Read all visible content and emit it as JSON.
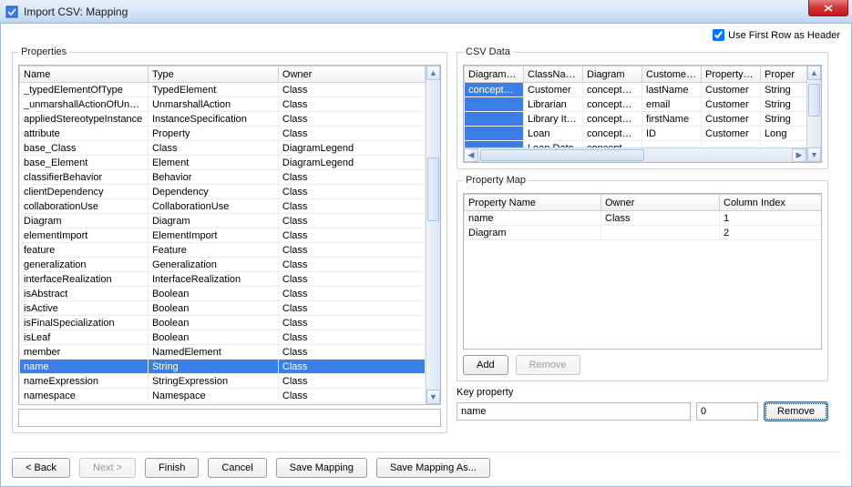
{
  "window": {
    "title": "Import CSV: Mapping"
  },
  "header_checkbox": {
    "label": "Use First Row as Header",
    "checked": true
  },
  "groups": {
    "properties": "Properties",
    "csv": "CSV Data",
    "propmap": "Property Map"
  },
  "properties_table": {
    "headers": [
      "Name",
      "Type",
      "Owner"
    ],
    "rows": [
      {
        "name": "_typedElementOfType",
        "type": "TypedElement",
        "owner": "Class"
      },
      {
        "name": "_unmarshallActionOfUnma...",
        "type": "UnmarshallAction",
        "owner": "Class"
      },
      {
        "name": "appliedStereotypeInstance",
        "type": "InstanceSpecification",
        "owner": "Class"
      },
      {
        "name": "attribute",
        "type": "Property",
        "owner": "Class"
      },
      {
        "name": "base_Class",
        "type": "Class",
        "owner": "DiagramLegend"
      },
      {
        "name": "base_Element",
        "type": "Element",
        "owner": "DiagramLegend"
      },
      {
        "name": "classifierBehavior",
        "type": "Behavior",
        "owner": "Class"
      },
      {
        "name": "clientDependency",
        "type": "Dependency",
        "owner": "Class"
      },
      {
        "name": "collaborationUse",
        "type": "CollaborationUse",
        "owner": "Class"
      },
      {
        "name": "Diagram",
        "type": "Diagram",
        "owner": "Class"
      },
      {
        "name": "elementImport",
        "type": "ElementImport",
        "owner": "Class"
      },
      {
        "name": "feature",
        "type": "Feature",
        "owner": "Class"
      },
      {
        "name": "generalization",
        "type": "Generalization",
        "owner": "Class"
      },
      {
        "name": "interfaceRealization",
        "type": "InterfaceRealization",
        "owner": "Class"
      },
      {
        "name": "isAbstract",
        "type": "Boolean",
        "owner": "Class"
      },
      {
        "name": "isActive",
        "type": "Boolean",
        "owner": "Class"
      },
      {
        "name": "isFinalSpecialization",
        "type": "Boolean",
        "owner": "Class"
      },
      {
        "name": "isLeaf",
        "type": "Boolean",
        "owner": "Class"
      },
      {
        "name": "member",
        "type": "NamedElement",
        "owner": "Class"
      },
      {
        "name": "name",
        "type": "String",
        "owner": "Class",
        "selected": true
      },
      {
        "name": "nameExpression",
        "type": "StringExpression",
        "owner": "Class"
      },
      {
        "name": "namespace",
        "type": "Namespace",
        "owner": "Class"
      }
    ],
    "filter": ""
  },
  "csv_table": {
    "headers": [
      "DiagramNa...",
      "ClassName",
      "Diagram",
      "CustomerP...",
      "PropertyO...",
      "Proper"
    ],
    "rows": [
      {
        "c": [
          "conceptUrlP...",
          "Customer",
          "conceptUrlP...",
          "lastName",
          "Customer",
          "String"
        ],
        "selFirst": true
      },
      {
        "c": [
          "",
          "Librarian",
          "conceptUrlP...",
          "email",
          "Customer",
          "String"
        ],
        "selFirst": true
      },
      {
        "c": [
          "",
          "Library Item",
          "conceptUrlP...",
          "firstName",
          "Customer",
          "String"
        ],
        "selFirst": true
      },
      {
        "c": [
          "",
          "Loan",
          "conceptUrlP...",
          "ID",
          "Customer",
          "Long"
        ],
        "selFirst": true
      },
      {
        "c": [
          "",
          "Loan Date",
          "conceptUrlP...",
          "",
          "",
          ""
        ],
        "selFirst": true
      }
    ]
  },
  "propmap_table": {
    "headers": [
      "Property Name",
      "Owner",
      "Column Index"
    ],
    "rows": [
      {
        "c": [
          "name",
          "Class",
          "1"
        ]
      },
      {
        "c": [
          "Diagram",
          "",
          "2"
        ]
      }
    ]
  },
  "buttons": {
    "add": "Add",
    "remove_map": "Remove",
    "remove_key": "Remove",
    "back": "< Back",
    "next": "Next >",
    "finish": "Finish",
    "cancel": "Cancel",
    "save_mapping": "Save Mapping",
    "save_mapping_as": "Save Mapping As..."
  },
  "key": {
    "label": "Key property",
    "value": "name",
    "index": "0"
  }
}
